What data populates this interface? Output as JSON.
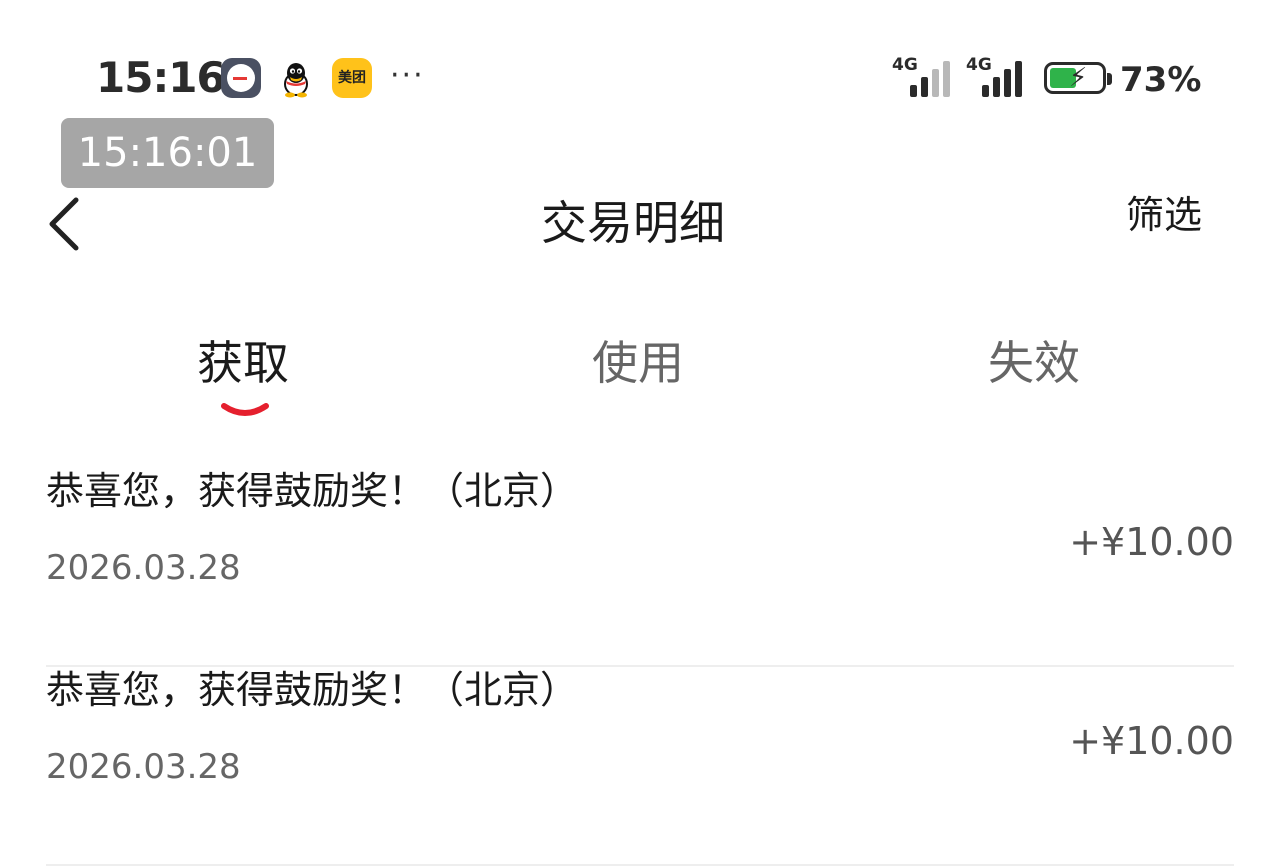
{
  "status_bar": {
    "time": "15:16",
    "network_1": "4G",
    "network_2": "4G",
    "battery": "73%",
    "more": "···",
    "meituan_label": "美团"
  },
  "overlay_time": "15:16:01",
  "nav": {
    "title": "交易明细",
    "filter": "筛选"
  },
  "tabs": [
    {
      "label": "获取",
      "active": true
    },
    {
      "label": "使用",
      "active": false
    },
    {
      "label": "失效",
      "active": false
    }
  ],
  "accent_color": "#e5202e",
  "transactions": [
    {
      "title": "恭喜您，获得鼓励奖！（北京）",
      "date": "2026.03.28",
      "amount": "+¥10.00"
    },
    {
      "title": "恭喜您，获得鼓励奖！（北京）",
      "date": "2026.03.28",
      "amount": "+¥10.00"
    }
  ]
}
